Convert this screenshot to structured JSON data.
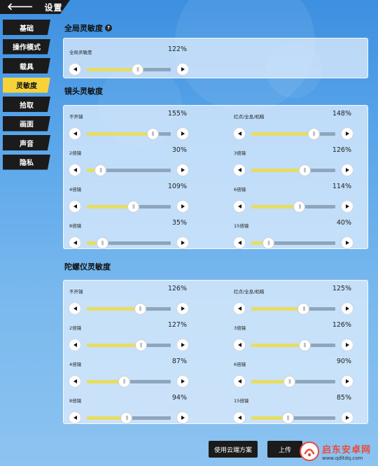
{
  "header": {
    "back_glyph": "🡐",
    "title": "设置"
  },
  "sidebar": {
    "items": [
      {
        "label": "基础",
        "active": false
      },
      {
        "label": "操作模式",
        "active": false
      },
      {
        "label": "载具",
        "active": false
      },
      {
        "label": "灵敏度",
        "active": true
      },
      {
        "label": "拾取",
        "active": false
      },
      {
        "label": "画面",
        "active": false
      },
      {
        "label": "声音",
        "active": false
      },
      {
        "label": "隐私",
        "active": false
      }
    ]
  },
  "global": {
    "title": "全局灵敏度",
    "help_glyph": "?",
    "slider": {
      "label": "全局灵敏度",
      "value": "122%",
      "fraction": 0.6
    }
  },
  "camera": {
    "title": "镜头灵敏度",
    "sliders": [
      {
        "label": "不开镜",
        "value": "155%",
        "fraction": 0.78
      },
      {
        "label": "红点/全息/机瞄",
        "value": "148%",
        "fraction": 0.74
      },
      {
        "label": "2倍镜",
        "value": "30%",
        "fraction": 0.16
      },
      {
        "label": "3倍镜",
        "value": "126%",
        "fraction": 0.63
      },
      {
        "label": "4倍镜",
        "value": "109%",
        "fraction": 0.55
      },
      {
        "label": "6倍镜",
        "value": "114%",
        "fraction": 0.57
      },
      {
        "label": "8倍镜",
        "value": "35%",
        "fraction": 0.18
      },
      {
        "label": "15倍镜",
        "value": "40%",
        "fraction": 0.2
      }
    ]
  },
  "gyro": {
    "title": "陀螺仪灵敏度",
    "sliders": [
      {
        "label": "不开镜",
        "value": "126%",
        "fraction": 0.63
      },
      {
        "label": "红点/全息/机瞄",
        "value": "125%",
        "fraction": 0.62
      },
      {
        "label": "2倍镜",
        "value": "127%",
        "fraction": 0.64
      },
      {
        "label": "3倍镜",
        "value": "126%",
        "fraction": 0.63
      },
      {
        "label": "4倍镜",
        "value": "87%",
        "fraction": 0.44
      },
      {
        "label": "6倍镜",
        "value": "90%",
        "fraction": 0.45
      },
      {
        "label": "8倍镜",
        "value": "94%",
        "fraction": 0.47
      },
      {
        "label": "15倍镜",
        "value": "85%",
        "fraction": 0.43
      }
    ]
  },
  "footer": {
    "cloud_button": "使用云端方案",
    "upload_button": "上传"
  },
  "watermark": {
    "name": "启东安卓网",
    "url": "www.qdltdq.com"
  },
  "colors": {
    "accent": "#f7d23a",
    "fill": "#e8dd62",
    "track": "#8ea5bc",
    "watermark": "#e84b3c"
  }
}
